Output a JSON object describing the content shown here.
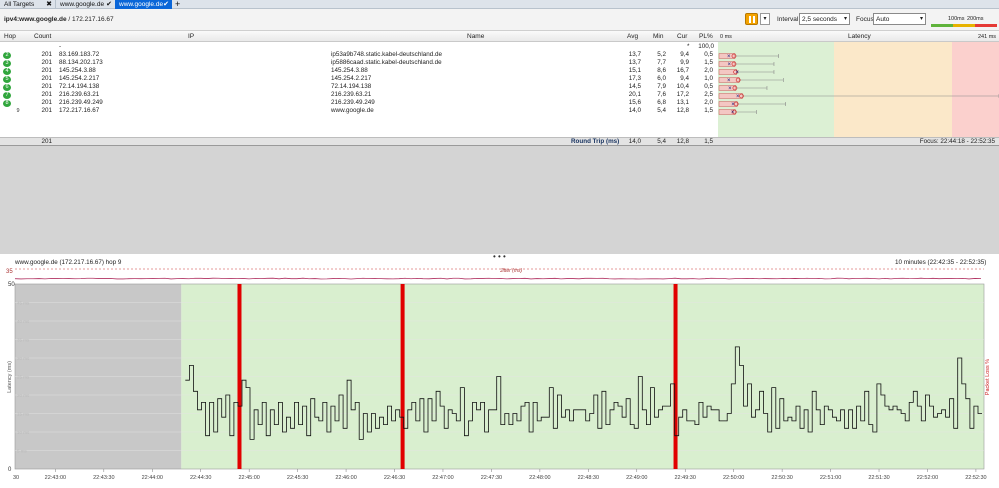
{
  "tabs": [
    {
      "label": "All Targets",
      "icon": "close-icon"
    },
    {
      "label": "www.google.de",
      "icon": "check-icon"
    },
    {
      "label": "www.google.de",
      "icon": "check-icon"
    }
  ],
  "tab_close_glyph": "✖",
  "tab_check_glyph": "✔",
  "add_tab_glyph": "+",
  "toolbar": {
    "target_bold": "ipv4:www.google.de",
    "target_rest": " / 172.217.16.67",
    "interval_label": "Interval",
    "interval_value": "2,5 seconds",
    "focus_label": "Focus",
    "focus_value": "Auto",
    "legend_100": "100ms",
    "legend_200": "200ms",
    "dropdown_glyph": "▾"
  },
  "columns": {
    "hop": "Hop",
    "count": "Count",
    "ip": "IP",
    "name": "Name",
    "avg": "Avg",
    "min": "Min",
    "cur": "Cur",
    "pl": "PL%",
    "latency_min": "0 ms",
    "latency": "Latency",
    "latency_max": "241 ms"
  },
  "first_row": {
    "ip": "-",
    "cur": "*",
    "pl": "100,0"
  },
  "hops": [
    {
      "hop": "2",
      "count": "201",
      "ip": "83.169.183.72",
      "name": "ip53a9b748.static.kabel-deutschland.de",
      "avg": "13,7",
      "min": "5,2",
      "cur": "9,4",
      "pl": "0,5"
    },
    {
      "hop": "3",
      "count": "201",
      "ip": "88.134.202.173",
      "name": "ip5886caad.static.kabel-deutschland.de",
      "avg": "13,7",
      "min": "7,7",
      "cur": "9,9",
      "pl": "1,5"
    },
    {
      "hop": "4",
      "count": "201",
      "ip": "145.254.3.88",
      "name": "145.254.3.88",
      "avg": "15,1",
      "min": "8,6",
      "cur": "16,7",
      "pl": "2,0"
    },
    {
      "hop": "5",
      "count": "201",
      "ip": "145.254.2.217",
      "name": "145.254.2.217",
      "avg": "17,3",
      "min": "6,0",
      "cur": "9,4",
      "pl": "1,0"
    },
    {
      "hop": "6",
      "count": "201",
      "ip": "72.14.194.138",
      "name": "72.14.194.138",
      "avg": "14,5",
      "min": "7,9",
      "cur": "10,4",
      "pl": "0,5"
    },
    {
      "hop": "7",
      "count": "201",
      "ip": "216.239.63.21",
      "name": "216.239.63.21",
      "avg": "20,1",
      "min": "7,6",
      "cur": "17,2",
      "pl": "2,5"
    },
    {
      "hop": "8",
      "count": "201",
      "ip": "216.239.49.249",
      "name": "216.239.49.249",
      "avg": "15,6",
      "min": "6,8",
      "cur": "13,1",
      "pl": "2,0"
    },
    {
      "hop": "9",
      "count": "201",
      "ip": "172.217.16.67",
      "name": "www.google.de",
      "avg": "14,0",
      "min": "5,4",
      "cur": "12,8",
      "pl": "1,5"
    }
  ],
  "summary": {
    "count": "201",
    "label": "Round Trip (ms)",
    "avg": "14,0",
    "min": "5,4",
    "cur": "12,8",
    "pl": "1,5",
    "focus": "Focus: 22:44:18 - 22:52:35"
  },
  "splitter_glyph": "• • •",
  "chart_title": "www.google.de (172.217.16.67) hop 9",
  "chart_range": "10 minutes (22:42:35 - 22:52:35)",
  "chart_data": {
    "type": "line",
    "title": "www.google.de (172.217.16.67) hop 9",
    "ylabel": "Latency (ms)",
    "y2label": "Packet Loss %",
    "ylim": [
      0,
      50
    ],
    "y_ticks": [
      "0",
      "5 ms",
      "10 ms",
      "15 ms",
      "20 ms",
      "25 ms",
      "30 ms",
      "35 ms",
      "40 ms",
      "45 ms",
      "50"
    ],
    "x_ticks": [
      "22:43:00",
      "22:43:30",
      "22:44:00",
      "22:44:30",
      "22:45:00",
      "22:45:30",
      "22:46:00",
      "22:46:30",
      "22:47:00",
      "22:47:30",
      "22:48:00",
      "22:48:30",
      "22:49:00",
      "22:49:30",
      "22:50:00",
      "22:50:30",
      "22:51:00",
      "22:51:30",
      "22:52:00",
      "22:52:30"
    ],
    "jitter_label": "Jitter (ms)",
    "jitter_top": "35",
    "start_label": "30",
    "gap_color": "#c8c8c8",
    "ok_color": "#d9efcf",
    "loss_color": "#e10000",
    "loss_events": [
      "22:44:54",
      "22:46:35",
      "22:49:24"
    ],
    "latency_series": [
      24,
      28,
      21,
      16,
      18,
      9,
      18,
      10,
      19,
      14,
      20,
      9,
      18,
      17,
      24,
      22,
      8,
      16,
      12,
      18,
      9,
      16,
      12,
      18,
      10,
      14,
      11,
      18,
      12,
      17,
      9,
      19,
      14,
      13,
      18,
      10,
      17,
      13,
      20,
      11,
      24,
      16,
      18,
      8,
      15,
      10,
      15,
      11,
      14,
      12,
      17,
      13,
      16,
      14,
      11,
      16,
      18,
      13,
      19,
      10,
      19,
      13,
      21,
      17,
      11,
      16,
      15,
      13,
      22,
      9,
      13,
      18,
      16,
      18,
      10,
      16,
      16,
      25,
      12,
      15,
      12,
      15,
      13,
      17,
      18,
      10,
      18,
      13,
      14,
      14,
      22,
      11,
      20,
      14,
      16,
      13,
      16,
      16,
      16,
      13,
      15,
      20,
      11,
      21,
      12,
      16,
      18,
      17,
      14,
      19,
      12,
      11,
      25,
      16,
      12,
      22,
      14,
      16,
      17,
      17,
      23,
      9,
      14,
      16,
      13,
      13,
      12,
      18,
      14,
      17,
      16,
      16,
      13,
      13,
      15,
      23,
      33,
      28,
      17,
      23,
      14,
      16,
      21,
      15,
      10,
      22,
      11,
      19,
      13,
      14,
      13,
      17,
      11,
      16,
      10,
      21,
      16,
      12,
      17,
      16,
      14,
      13,
      16,
      11,
      16,
      11,
      17,
      13,
      21,
      12,
      10,
      23,
      20,
      17,
      16,
      17,
      16,
      15,
      13,
      18,
      21,
      17,
      13,
      20,
      17,
      14,
      15,
      16,
      14,
      19,
      11,
      30,
      23,
      19,
      11,
      17,
      15
    ]
  }
}
